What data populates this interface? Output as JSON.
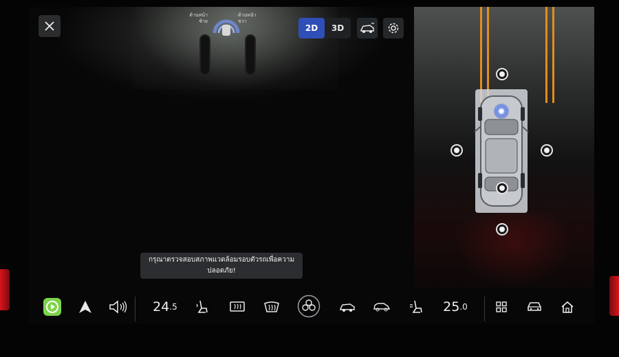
{
  "view_modes": {
    "mode_2d": "2D",
    "mode_3d": "3D",
    "selected": "2D"
  },
  "mini_indicator": {
    "left_text": "ด้านหน้า\nซ้าย",
    "right_text": "ด้านหน้า\nขวา"
  },
  "toast": {
    "message": "กรุณาตรวจสอบสภาพแวดล้อมรอบตัวรถเพื่อความปลอดภัย!"
  },
  "dock": {
    "driver_temp": {
      "main": "24",
      "decimal": ".5"
    },
    "passenger_temp": {
      "main": "25",
      "decimal": ".0"
    }
  },
  "colors": {
    "active_segment": "#2f4fb8",
    "guide_lines": "#e48d1c",
    "bezel_glow": "#d8141c",
    "carplay_green": "#7dd44a"
  },
  "icons": [
    "close-icon",
    "camera-view-icon",
    "settings-gear-icon",
    "carplay-icon",
    "android-auto-icon",
    "volume-icon",
    "seat-heat-icon",
    "rear-defrost-icon",
    "front-defrost-icon",
    "fan-icon",
    "car-view-icon",
    "car-side-icon",
    "seat-ventilation-icon",
    "apps-grid-icon",
    "car-icon",
    "home-icon"
  ]
}
